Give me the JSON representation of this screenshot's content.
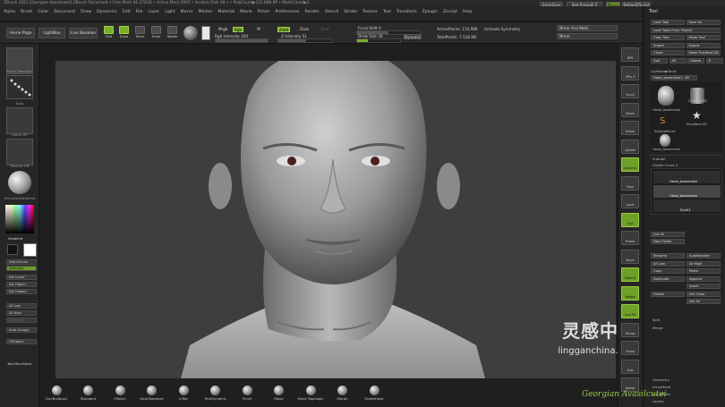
{
  "window": {
    "title": "ZBrush 2021 [Georgian Avasilcutei]   ZBrush Document   • Free Mem 44.372GB • Active Mem 2907 • Scratch Disk 48 • • PolyCount▶115.688 KP • MeshCount▶2"
  },
  "menu": [
    "Alpha",
    "Brush",
    "Color",
    "Document",
    "Draw",
    "Dynamics",
    "Edit",
    "File",
    "Layer",
    "Light",
    "Macro",
    "Marker",
    "Material",
    "Movie",
    "Picker",
    "Preferences",
    "Render",
    "Stencil",
    "Stroke",
    "Texture",
    "Tool",
    "Transform",
    "Zplugin",
    "Zscript",
    "Help"
  ],
  "topright": {
    "quicksave": "QuickSave",
    "seethrough": "See-through 0",
    "menus": "Menus",
    "defaultzscript": "DefaultZScript"
  },
  "toolbar": {
    "home_page": "Home Page",
    "lightbox": "LightBox",
    "live_boolean": "Live Boolean",
    "icons": [
      "Edit",
      "Draw",
      "Move",
      "Scale",
      "Rotate"
    ],
    "mrgb": "Mrgb",
    "rgb": "Rgb",
    "m": "M",
    "rgb_intensity": "Rgb Intensity 100",
    "zadd": "Zadd",
    "zsub": "Zsub",
    "zcut": "Zcut",
    "z_intensity": "Z Intensity 51",
    "focal_shift": "Focal Shift 0",
    "draw_size": "Draw Size 30",
    "dynamic": "Dynamic",
    "active_points": "ActivePoints: 110,989",
    "total_points": "TotalPoints: 7.516 Mil",
    "activate_symmetry": "Activate Symmetry",
    "mirror_weld": "Mirror And Weld",
    "mirror": "Mirror"
  },
  "leftpanel": {
    "brush_label": "Move Topologic",
    "stroke_label": "Dots",
    "alpha_label": "Alpha Off",
    "texture_label": "Texture Off",
    "material_label": "SkinshadeMaterial",
    "gradient": "Gradient",
    "buttons": [
      "SwitchColor",
      "Alternate",
      "Del Lower",
      "Del Higher",
      "Del Hidden",
      "All Low",
      "All High",
      "Create All",
      "Auto Groups",
      "FillObject"
    ],
    "backface": "BackfaceMask"
  },
  "tool": {
    "header": "Tool",
    "rows": [
      [
        "Load Tool",
        "Save As"
      ],
      [
        "Load Tools From Project"
      ],
      [
        "Copy Tool",
        "Paste Tool"
      ],
      [
        "Import",
        "Export"
      ],
      [
        "Clone",
        "Make PolyMesh3D"
      ],
      [
        "GoZ",
        "All",
        "Visible",
        "R"
      ]
    ],
    "lightbox_tools": "Lightbox▶Tools",
    "current": "Head_basemesh1. 48",
    "thumbs": [
      "Head_basemesh",
      "Cylinder3D",
      "PolyMesh3D",
      "SimpleBrush",
      "Head_basemesh"
    ],
    "subtool_header": "Subtool",
    "visible_count": "Visible Count 4",
    "subtools": [
      "Head_basemesh",
      "Head_basemesh",
      "Eye01"
    ],
    "list_all": "List All",
    "new_folder": "New Folder",
    "actions": [
      [
        "Rename",
        "AutoReorder"
      ],
      [
        "All Low",
        "All High"
      ],
      [
        "Copy",
        "Paste"
      ],
      [
        "Duplicate",
        "Append"
      ],
      [
        "",
        "Insert"
      ],
      [
        "Delete",
        "Del Other"
      ],
      [
        "",
        "Del All"
      ]
    ],
    "split": "Split",
    "merge": "Merge",
    "bottom": [
      "Geometry",
      "ArrayMesh",
      "NanoMesh",
      "Layers"
    ],
    "export": "Export"
  },
  "rightshelf": [
    "BPR",
    "SPix 3",
    "Scroll",
    "Zoom",
    "Actual",
    "AAHalf",
    "Dynamic Persp",
    "Floor",
    "Local",
    "Gyz",
    "Frame",
    "Move",
    "ZoomD",
    "Rotate",
    "Line Fill PolyF",
    "Transp",
    "Ghost",
    "Solo",
    "Xpose"
  ],
  "brushes": [
    "ClayBuildup1",
    "Standard",
    "hPolish",
    "DamStandard",
    "Inflat",
    "TrimDynamic",
    "Pinch",
    "Move",
    "Move Topologic",
    "Morph",
    "SnakeHook"
  ],
  "watermark": {
    "logo": "灵感中国",
    "url": "lingganchina.com"
  },
  "credit": "Georgian Avasilcutei",
  "colors": {
    "accent": "#7aae2c",
    "viewport_bg": "#3e3e3e"
  }
}
